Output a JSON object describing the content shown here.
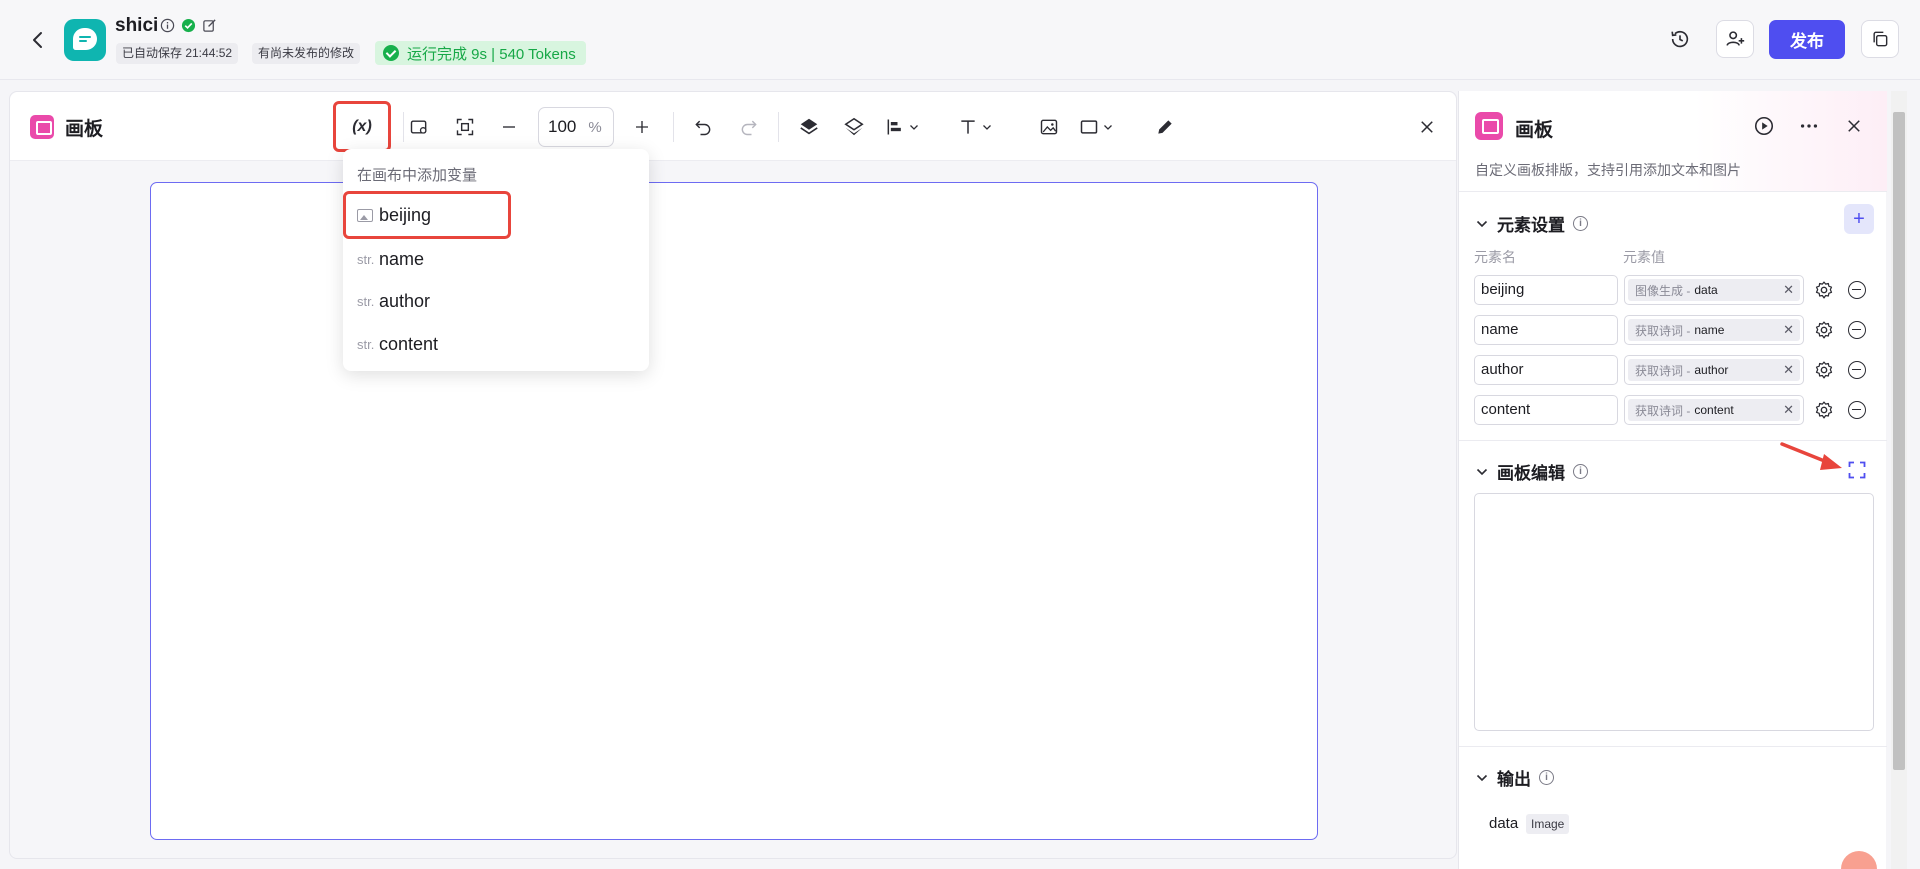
{
  "header": {
    "app_name": "shici",
    "autosave_label": "已自动保存 21:44:52",
    "unpublished_label": "有尚未发布的修改",
    "run_status": "运行完成 9s | 540 Tokens",
    "publish_label": "发布"
  },
  "canvas": {
    "title": "画板",
    "var_tool_label": "(x)",
    "zoom_value": "100",
    "zoom_unit": "%",
    "dropdown": {
      "title": "在画布中添加变量",
      "items": [
        {
          "type": "image",
          "label": "beijing"
        },
        {
          "type": "str.",
          "label": "name"
        },
        {
          "type": "str.",
          "label": "author"
        },
        {
          "type": "str.",
          "label": "content"
        }
      ]
    }
  },
  "panel": {
    "title": "画板",
    "description": "自定义画板排版，支持引用添加文本和图片",
    "element_section": {
      "title": "元素设置",
      "col_name": "元素名",
      "col_value": "元素值",
      "rows": [
        {
          "name": "beijing",
          "source": "图像生成 -",
          "field": "data"
        },
        {
          "name": "name",
          "source": "获取诗词 -",
          "field": "name"
        },
        {
          "name": "author",
          "source": "获取诗词 -",
          "field": "author"
        },
        {
          "name": "content",
          "source": "获取诗词 -",
          "field": "content"
        }
      ]
    },
    "editor_section": {
      "title": "画板编辑"
    },
    "output_section": {
      "title": "输出",
      "name": "data",
      "type": "Image"
    }
  },
  "colors": {
    "accent": "#4f4ef0",
    "brand_pink": "#ea4aaa",
    "success": "#17a847",
    "highlight_red": "#e8453c"
  }
}
